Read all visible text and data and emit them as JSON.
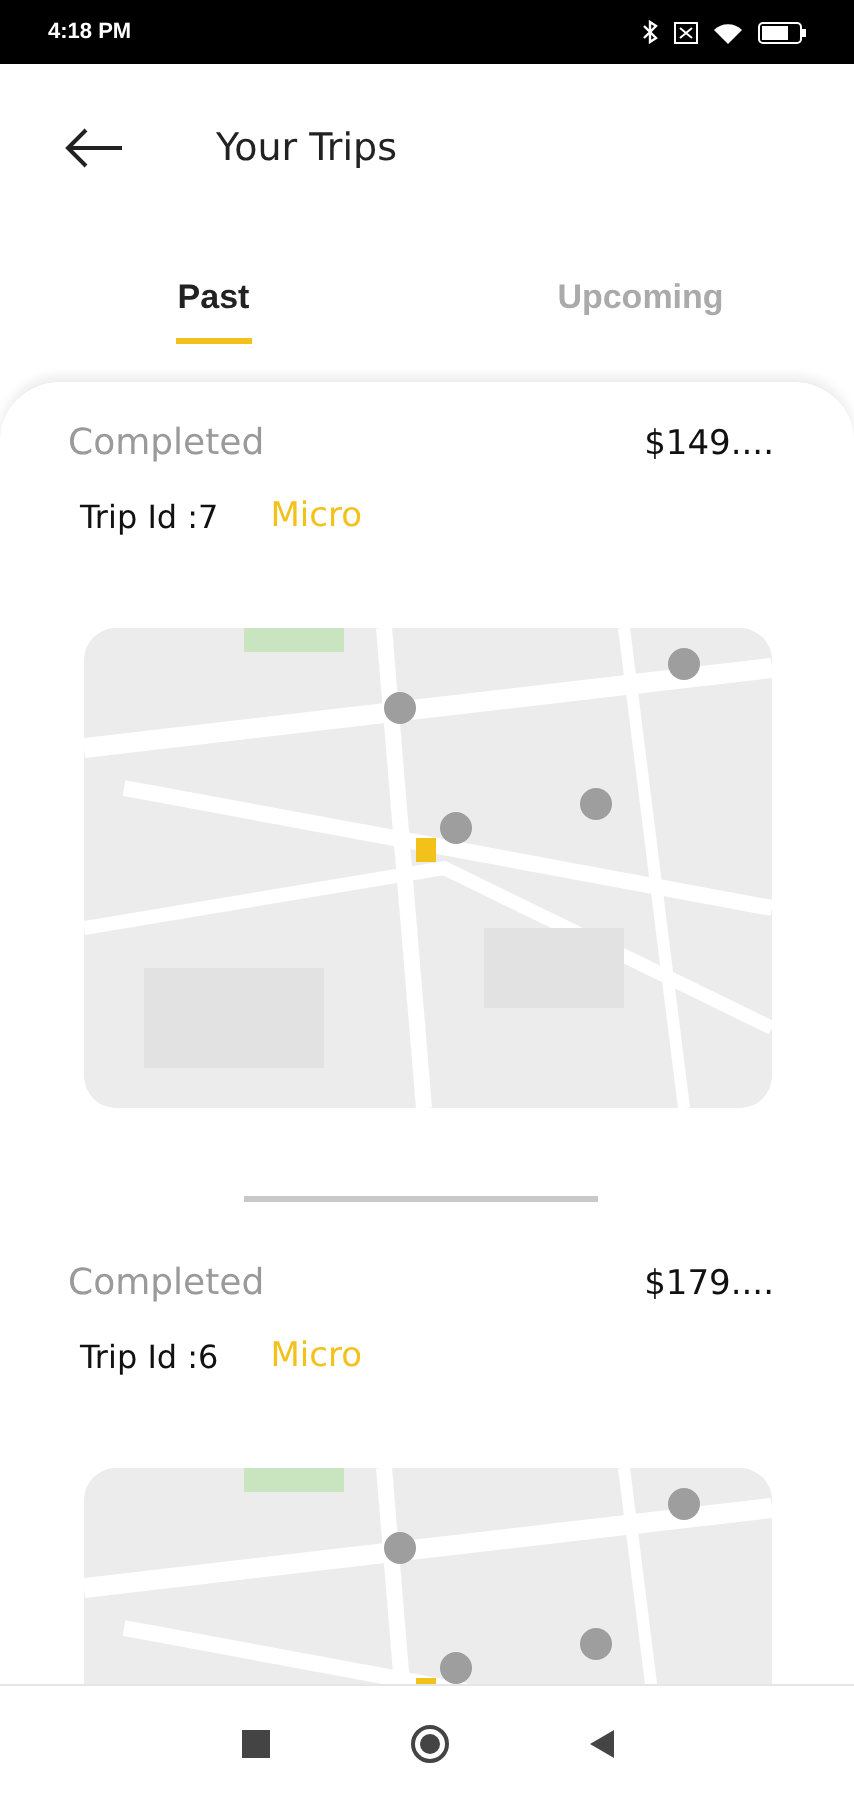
{
  "status_bar": {
    "time": "4:18 PM"
  },
  "header": {
    "title": "Your Trips"
  },
  "tabs": [
    {
      "label": "Past",
      "selected": true
    },
    {
      "label": "Upcoming",
      "selected": false
    }
  ],
  "trips": [
    {
      "status": "Completed",
      "price": "$149....",
      "trip_id": "Trip Id :7",
      "vehicle": "Micro"
    },
    {
      "status": "Completed",
      "price": "$179....",
      "trip_id": "Trip Id :6",
      "vehicle": "Micro"
    }
  ]
}
